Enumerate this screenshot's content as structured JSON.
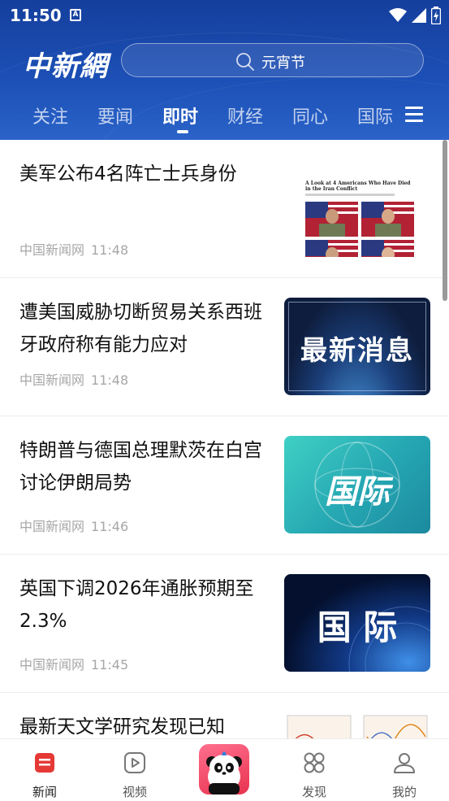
{
  "status": {
    "time": "11:50",
    "notif_letter": "A"
  },
  "header": {
    "logo": "中新網",
    "search_placeholder": "元宵节",
    "tabs": [
      {
        "label": "关注",
        "active": false
      },
      {
        "label": "要闻",
        "active": false
      },
      {
        "label": "即时",
        "active": true
      },
      {
        "label": "财经",
        "active": false
      },
      {
        "label": "同心",
        "active": false
      },
      {
        "label": "国际",
        "active": false
      }
    ]
  },
  "news": [
    {
      "title": "美军公布4名阵亡士兵身份",
      "source": "中国新闻网",
      "time": "11:48",
      "thumb": "soldiers-photo"
    },
    {
      "title": "遭美国威胁切断贸易关系西班牙政府称有能力应对",
      "source": "中国新闻网",
      "time": "11:48",
      "thumb_text": "最新消息"
    },
    {
      "title": "特朗普与德国总理默茨在白宫讨论伊朗局势",
      "source": "中国新闻网",
      "time": "11:46",
      "thumb_text": "国际"
    },
    {
      "title": "英国下调2026年通胀预期至2.3%",
      "source": "中国新闻网",
      "time": "11:45",
      "thumb_text": "国 际"
    },
    {
      "title": "最新天文学研究发现已知",
      "source": "",
      "time": "",
      "thumb": "astronomy-charts"
    }
  ],
  "thumb_article_heading": "A Look at 4 Americans Who Have Died in the Iran Conflict",
  "bottom_nav": [
    {
      "label": "新闻",
      "active": true,
      "icon": "news-icon"
    },
    {
      "label": "视频",
      "active": false,
      "icon": "video-icon"
    },
    {
      "label": "",
      "active": false,
      "icon": "panda-mascot-icon"
    },
    {
      "label": "发现",
      "active": false,
      "icon": "discover-icon"
    },
    {
      "label": "我的",
      "active": false,
      "icon": "profile-icon"
    }
  ],
  "colors": {
    "header": "#1c4fb5",
    "accent": "#e53935",
    "meta": "#a7a7a7"
  }
}
